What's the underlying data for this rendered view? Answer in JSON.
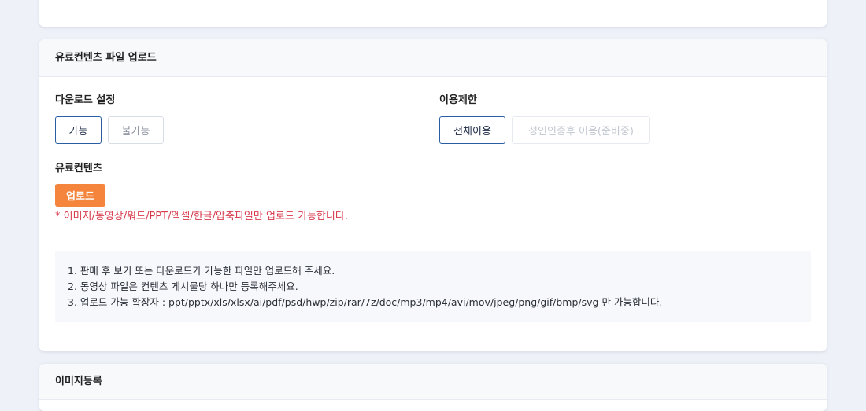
{
  "paid_upload": {
    "title": "유료컨텐츠 파일 업로드",
    "download_setting": {
      "label": "다운로드 설정",
      "options": [
        "가능",
        "불가능"
      ],
      "selected": "가능"
    },
    "usage_limit": {
      "label": "이용제한",
      "options": [
        "전체이용",
        "성인인증후 이용(준비중)"
      ],
      "selected": "전체이용"
    },
    "paid_content": {
      "label": "유료컨텐츠",
      "upload_label": "업로드",
      "notice": "* 이미지/동영상/워드/PPT/엑셀/한글/압축파일만 업로드 가능합니다."
    },
    "info_lines": [
      "1. 판매 후 보기 또는 다운로드가 가능한 파일만 업로드해 주세요.",
      "2. 동영상 파일은 컨텐츠 게시물당 하나만 등록해주세요.",
      "3. 업로드 가능 확장자 : ppt/pptx/xls/xlsx/ai/pdf/psd/hwp/zip/rar/7z/doc/mp3/mp4/avi/mov/jpeg/png/gif/bmp/svg 만 가능합니다."
    ]
  },
  "image_register": {
    "title": "이미지등록"
  },
  "colors": {
    "accent_orange": "#f5853c",
    "selected_border": "#2a5ea3",
    "notice_red": "#d7384a",
    "page_bg": "#eef1f8"
  }
}
